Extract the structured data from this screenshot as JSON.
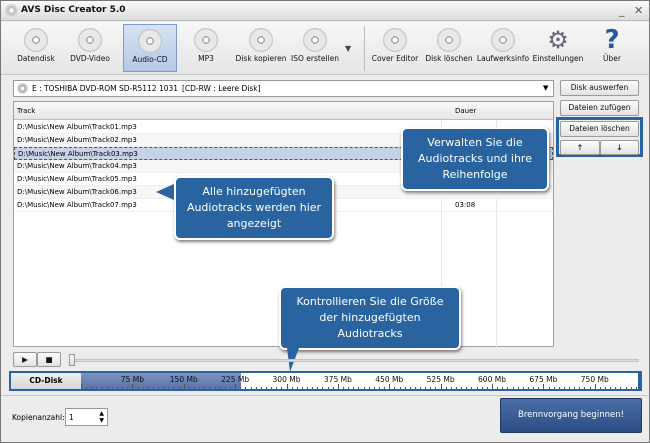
{
  "window": {
    "title": "AVS Disc Creator 5.0",
    "minimize": "_",
    "close": "✕"
  },
  "toolbar": [
    {
      "label": "Datendisk",
      "icon": "data-disc-icon"
    },
    {
      "label": "DVD-Video",
      "icon": "dvd-video-icon"
    },
    {
      "label": "Audio-CD",
      "icon": "audio-cd-icon",
      "selected": true
    },
    {
      "label": "MP3",
      "icon": "mp3-icon"
    },
    {
      "label": "Disk kopieren",
      "icon": "copy-disc-icon"
    },
    {
      "label": "ISO erstellen",
      "icon": "iso-icon"
    },
    {
      "label": "Cover Editor",
      "icon": "cover-editor-icon"
    },
    {
      "label": "Disk löschen",
      "icon": "erase-disc-icon"
    },
    {
      "label": "Laufwerksinfo",
      "icon": "drive-info-icon"
    },
    {
      "label": "Einstellungen",
      "icon": "gear-icon"
    },
    {
      "label": "Über",
      "icon": "help-icon"
    }
  ],
  "drive": {
    "name": "E : TOSHIBA  DVD-ROM SD-R5112 1031",
    "status": "[CD-RW : Leere Disk]"
  },
  "side_buttons": {
    "eject": "Disk auswerfen",
    "add": "Dateien zufügen",
    "delete": "Dateien löschen",
    "up": "🡑",
    "down": "🡓"
  },
  "list": {
    "headers": {
      "track": "Track",
      "duration": "Dauer"
    },
    "rows": [
      {
        "track": "D:\\Music\\New Album\\Track01.mp3",
        "duration": ""
      },
      {
        "track": "D:\\Music\\New Album\\Track02.mp3",
        "duration": ""
      },
      {
        "track": "D:\\Music\\New Album\\Track03.mp3",
        "duration": "",
        "selected": true
      },
      {
        "track": "D:\\Music\\New Album\\Track04.mp3",
        "duration": ""
      },
      {
        "track": "D:\\Music\\New Album\\Track05.mp3",
        "duration": ""
      },
      {
        "track": "D:\\Music\\New Album\\Track06.mp3",
        "duration": ""
      },
      {
        "track": "D:\\Music\\New Album\\Track07.mp3",
        "duration": "03:08"
      }
    ]
  },
  "callouts": {
    "tracks": "Alle hinzugefügten Audiotracks werden hier angezeigt",
    "manage": "Verwalten Sie die Audiotracks und ihre Reihenfolge",
    "size": "Kontrollieren Sie die Größe der hinzugefügten Audiotracks"
  },
  "sizebar": {
    "label": "CD-Disk",
    "used_mb": 234,
    "capacity_mb": 813,
    "ticks": [
      "75 Mb",
      "150 Mb",
      "225 Mb",
      "300 Mb",
      "375 Mb",
      "450 Mb",
      "525 Mb",
      "600 Mb",
      "675 Mb",
      "750 Mb"
    ]
  },
  "bottom": {
    "copies_label": "Kopienanzahl:",
    "copies_value": "1",
    "burn": "Brennvorgang beginnen!"
  },
  "colors": {
    "accent": "#2a64a0",
    "fill": "#5872a8",
    "limit": "#e02020"
  }
}
